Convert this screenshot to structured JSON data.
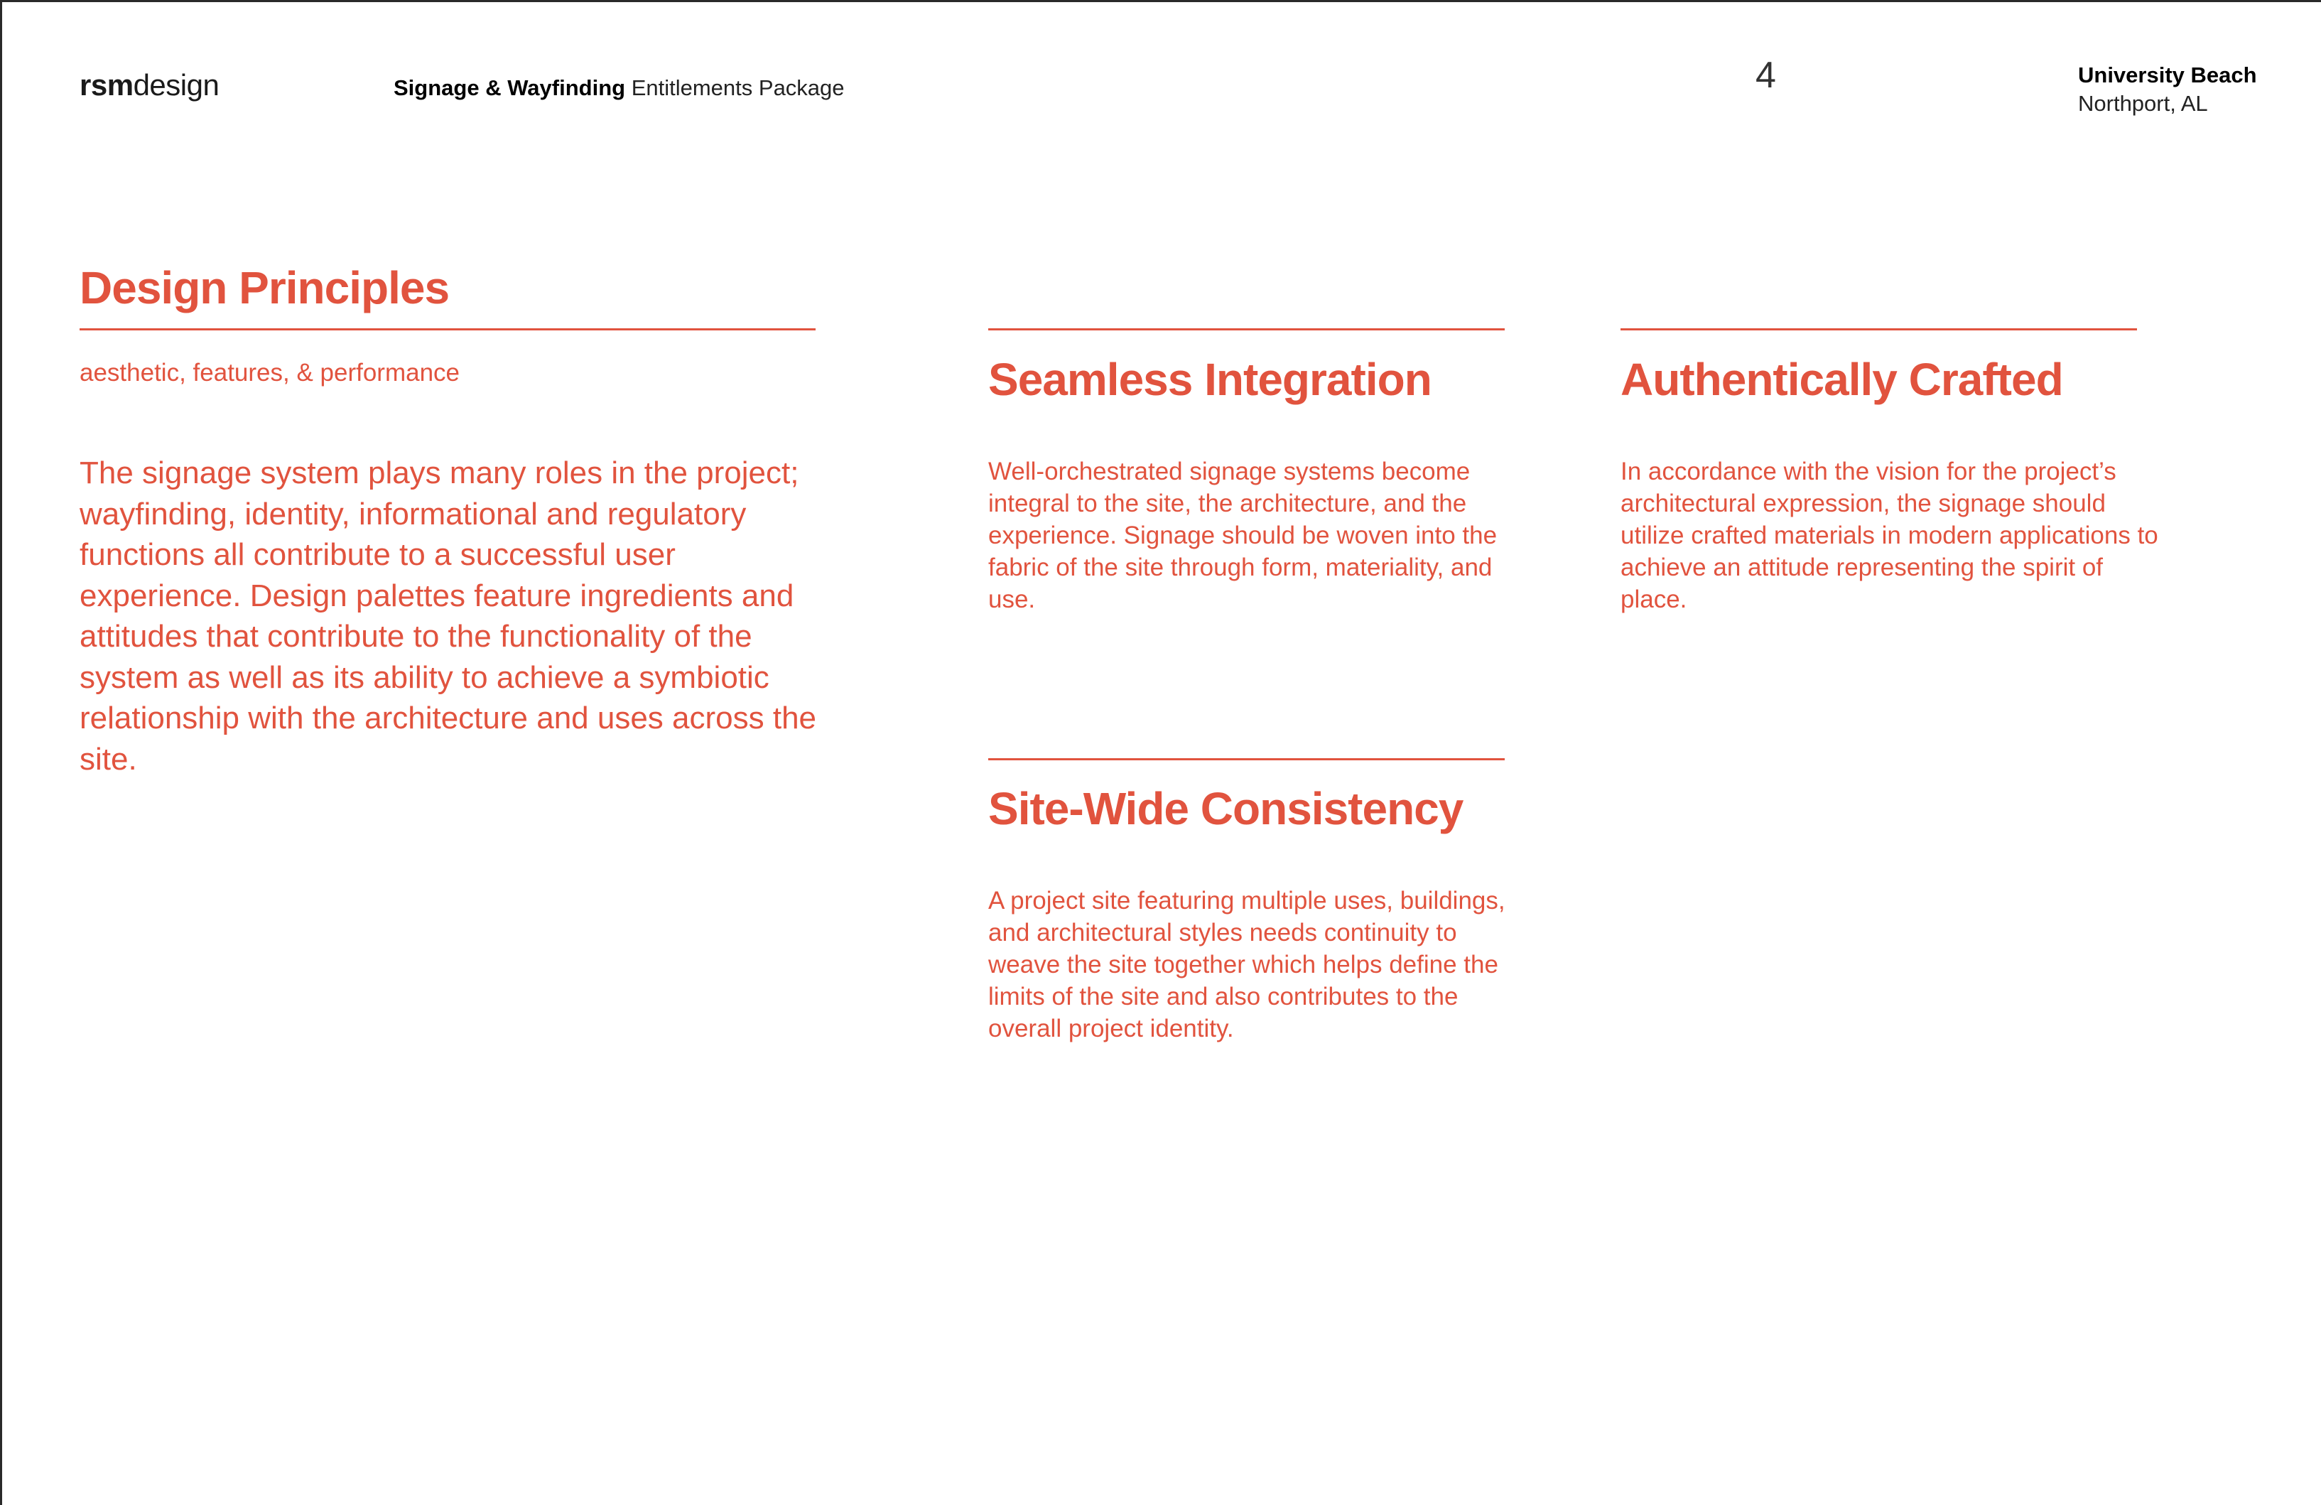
{
  "header": {
    "brand_bold": "rsm",
    "brand_light": "design",
    "doc_bold": "Signage & Wayfinding",
    "doc_light": "Entitlements Package",
    "page_number": "4",
    "project_name": "University Beach",
    "project_location": "Northport, AL"
  },
  "principles": {
    "title": "Design Principles",
    "subtitle": "aesthetic, features, & performance",
    "lead": "The signage system plays many roles in the project; wayfinding, identity, informational and regulatory functions all contribute to a successful user experience. Design palettes feature ingredients and attitudes that contribute to the functionality of the system as well as its ability to achieve a symbiotic relationship with the architecture and uses across the site."
  },
  "sections": [
    {
      "heading": "Seamless Integration",
      "body": "Well-orchestrated signage systems become integral to the site, the architecture, and the experience. Signage should be woven into the fabric of the site through form, materiality, and use."
    },
    {
      "heading": "Authentically Crafted",
      "body": "In accordance with the vision for the project’s architectural expression, the signage should utilize crafted materials in modern applications to achieve an attitude representing the spirit of place."
    },
    {
      "heading": "Site-Wide Consistency",
      "body": "A project site featuring multiple uses, buildings, and architectural styles needs continuity to weave the site together which helps define the limits of the site and also contributes to the overall project identity."
    }
  ],
  "colors": {
    "accent": "#e1533e",
    "text": "#111111"
  }
}
